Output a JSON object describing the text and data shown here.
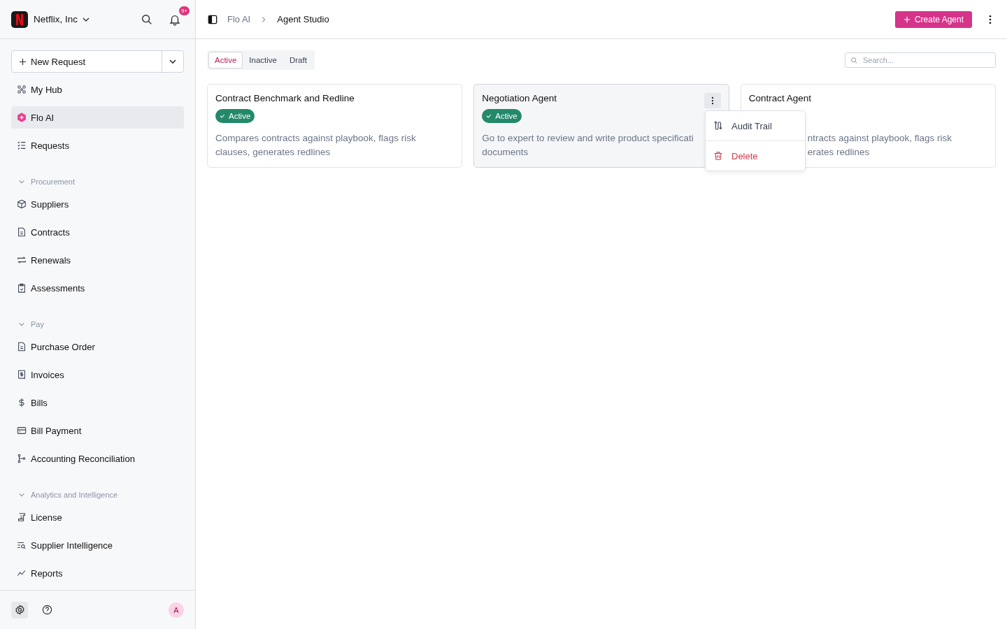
{
  "org": {
    "name": "Netflix, Inc",
    "notifications": "9+"
  },
  "new_request": {
    "label": "New Request"
  },
  "nav": [
    {
      "kind": "item",
      "label": "My Hub",
      "selected": false
    },
    {
      "kind": "item",
      "label": "Flo AI",
      "selected": true
    },
    {
      "kind": "item",
      "label": "Requests",
      "selected": false
    },
    {
      "kind": "section",
      "label": "Procurement",
      "expanded": true
    },
    {
      "kind": "item",
      "label": "Suppliers",
      "selected": false
    },
    {
      "kind": "item",
      "label": "Contracts",
      "selected": false
    },
    {
      "kind": "item",
      "label": "Renewals",
      "selected": false
    },
    {
      "kind": "item",
      "label": "Assessments",
      "selected": false
    },
    {
      "kind": "section",
      "label": "Pay",
      "expanded": true
    },
    {
      "kind": "item",
      "label": "Purchase Order",
      "selected": false
    },
    {
      "kind": "item",
      "label": "Invoices",
      "selected": false
    },
    {
      "kind": "item",
      "label": "Bills",
      "selected": false
    },
    {
      "kind": "item",
      "label": "Bill Payment",
      "selected": false
    },
    {
      "kind": "item",
      "label": "Accounting Reconciliation",
      "selected": false
    },
    {
      "kind": "section",
      "label": "Analytics and Intelligence",
      "expanded": true
    },
    {
      "kind": "item",
      "label": "License",
      "selected": false
    },
    {
      "kind": "item",
      "label": "Supplier Intelligence",
      "selected": false
    },
    {
      "kind": "item",
      "label": "Reports",
      "selected": false
    }
  ],
  "user": {
    "initial": "A"
  },
  "breadcrumb": [
    "Flo AI",
    "Agent Studio"
  ],
  "create_button": "Create Agent",
  "tabs": [
    {
      "label": "Active",
      "selected": true
    },
    {
      "label": "Inactive",
      "selected": false
    },
    {
      "label": "Draft",
      "selected": false
    }
  ],
  "search": {
    "placeholder": "Search..."
  },
  "cards": [
    {
      "title": "Contract Benchmark and Redline",
      "status": "Active",
      "description": [
        "Compares contracts against playbook, flags risk",
        "clauses, generates redlines"
      ],
      "hovered": false,
      "covered": false
    },
    {
      "title": "Negotiation Agent",
      "status": "Active",
      "description": [
        "Go to expert to review and write product specificati",
        "documents"
      ],
      "hovered": true,
      "covered": false
    },
    {
      "title": "Contract Agent",
      "description": [
        "ntracts against playbook, flags risk",
        "erates redlines"
      ],
      "hovered": false,
      "covered": true
    }
  ],
  "menu": [
    {
      "kind": "normal",
      "label": "Audit Trail"
    },
    {
      "kind": "danger",
      "label": "Delete"
    }
  ]
}
